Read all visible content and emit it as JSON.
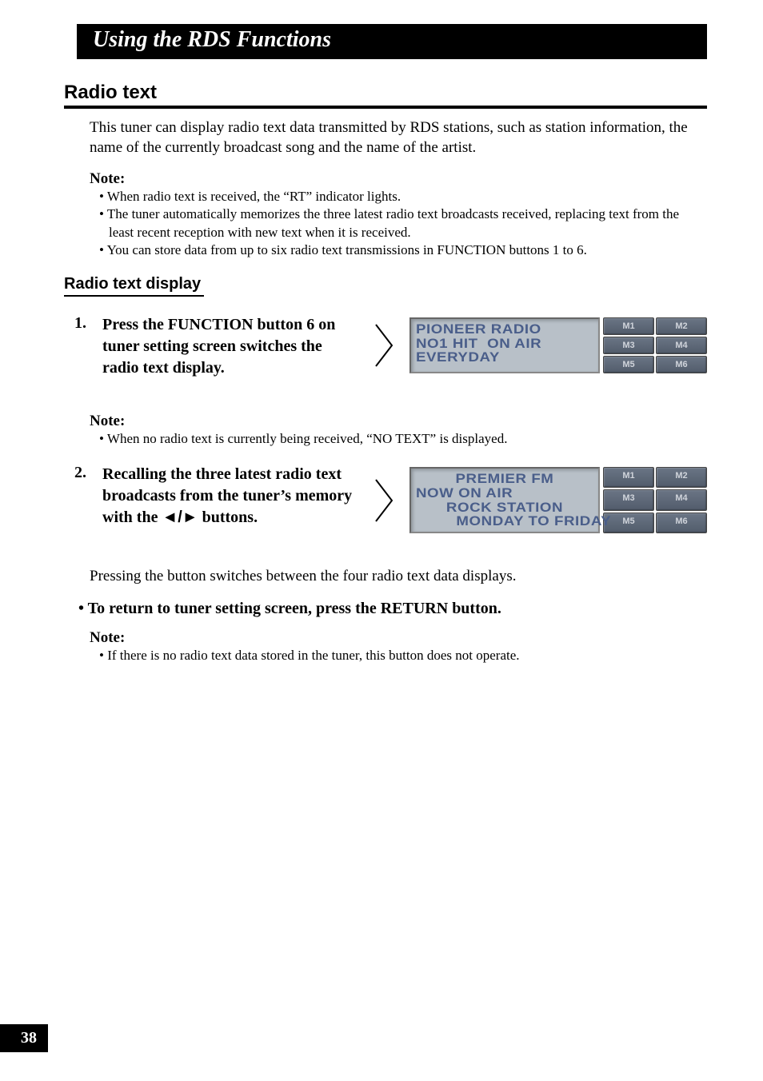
{
  "header": {
    "title": "Using the RDS Functions"
  },
  "section": {
    "title": "Radio text"
  },
  "intro": "This tuner can display radio text data transmitted by RDS stations, such as station information, the name of the currently broadcast song and the name of the artist.",
  "note_label": "Note:",
  "notes1": [
    "When radio text is received, the “RT” indicator lights.",
    "The tuner automatically memorizes the three latest radio text broadcasts received, replacing text from the least recent reception with new text when it is received.",
    "You can store data from up to six radio text transmissions in FUNCTION buttons 1 to 6."
  ],
  "subsection": {
    "title": "Radio text display"
  },
  "steps": [
    {
      "num": "1.",
      "text": "Press the FUNCTION button 6 on tuner setting screen switches the radio text display.",
      "lcd": [
        "PIONEER RADIO",
        "NO1 HIT  ON AIR",
        "EVERYDAY"
      ],
      "lcd_align": [
        "left",
        "left",
        "left"
      ]
    },
    {
      "num": "2.",
      "text_prefix": "Recalling the three latest radio text broadcasts from the tuner’s memory with the ",
      "text_suffix": " buttons.",
      "arrows": "◄/►",
      "lcd": [
        "PREMIER FM",
        "NOW ON AIR",
        "ROCK STATION",
        "MONDAY TO FRIDAY"
      ],
      "lcd_align": [
        "center",
        "left",
        "center",
        "right"
      ]
    }
  ],
  "mem_buttons": [
    "M1",
    "M2",
    "M3",
    "M4",
    "M5",
    "M6"
  ],
  "notes2_label": "Note:",
  "notes2": [
    "When no radio text is currently being received, “NO TEXT” is displayed."
  ],
  "after_step2": "Pressing the button switches between the four radio text data displays.",
  "return_line": "To return to tuner setting screen, press the RETURN button.",
  "notes3_label": "Note:",
  "notes3": [
    "If there is no radio text data stored in the tuner, this button does not operate."
  ],
  "page_number": "38"
}
